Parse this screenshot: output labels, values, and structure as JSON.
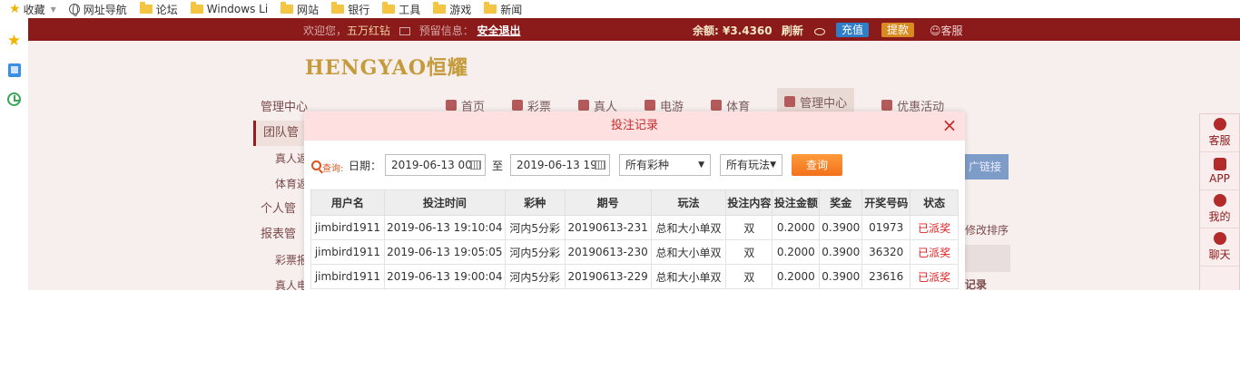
{
  "bookmarks": [
    {
      "label": "收藏",
      "icon": "star-icon",
      "dropdown": true
    },
    {
      "label": "网址导航",
      "icon": "globe-icon"
    },
    {
      "label": "论坛",
      "icon": "folder-icon"
    },
    {
      "label": "Windows Li",
      "icon": "folder-icon"
    },
    {
      "label": "网站",
      "icon": "folder-icon"
    },
    {
      "label": "银行",
      "icon": "folder-icon"
    },
    {
      "label": "工具",
      "icon": "folder-icon"
    },
    {
      "label": "游戏",
      "icon": "folder-icon"
    },
    {
      "label": "新闻",
      "icon": "folder-icon"
    }
  ],
  "site_top": {
    "welcome": "欢迎您，",
    "username": "五万红钻",
    "notice": "预留信息：",
    "logout": "安全退出",
    "balance": "余额: ¥3.4360",
    "refresh": "刷新",
    "recharge": "充值",
    "withdraw": "提款",
    "service": "客服"
  },
  "logo": "HENGYAO恒耀",
  "nav": [
    "首页",
    "彩票",
    "真人",
    "电游",
    "体育",
    "管理中心",
    "优惠活动"
  ],
  "menu_left": [
    "管理中心",
    "团队管",
    "真人返",
    "体育返",
    "个人管",
    "报表管",
    "彩票报",
    "真人电"
  ],
  "behind_links": {
    "promo": "广链接",
    "sort": "修改排序",
    "record": "记录"
  },
  "float_bar": [
    "客服",
    "APP",
    "我的",
    "聊天"
  ],
  "modal": {
    "title": "投注记录",
    "close": "×",
    "query_label": "查询:",
    "date_label": "日期：",
    "start_date": "2019-06-13 00:",
    "to_label": "至",
    "end_date": "2019-06-13 19:",
    "lottery_select": "所有彩种",
    "play_select": "所有玩法",
    "query_button": "查询",
    "table": {
      "headers": [
        "用户名",
        "投注时间",
        "彩种",
        "期号",
        "玩法",
        "投注内容",
        "投注金额",
        "奖金",
        "开奖号码",
        "状态"
      ],
      "rows": [
        [
          "jimbird1911",
          "2019-06-13 19:10:04",
          "河内5分彩",
          "20190613-231",
          "总和大小单双",
          "双",
          "0.2000",
          "0.3900",
          "01973",
          "已派奖"
        ],
        [
          "jimbird1911",
          "2019-06-13 19:05:05",
          "河内5分彩",
          "20190613-230",
          "总和大小单双",
          "双",
          "0.2000",
          "0.3900",
          "36320",
          "已派奖"
        ],
        [
          "jimbird1911",
          "2019-06-13 19:00:04",
          "河内5分彩",
          "20190613-229",
          "总和大小单双",
          "双",
          "0.2000",
          "0.3900",
          "23616",
          "已派奖"
        ]
      ]
    }
  }
}
